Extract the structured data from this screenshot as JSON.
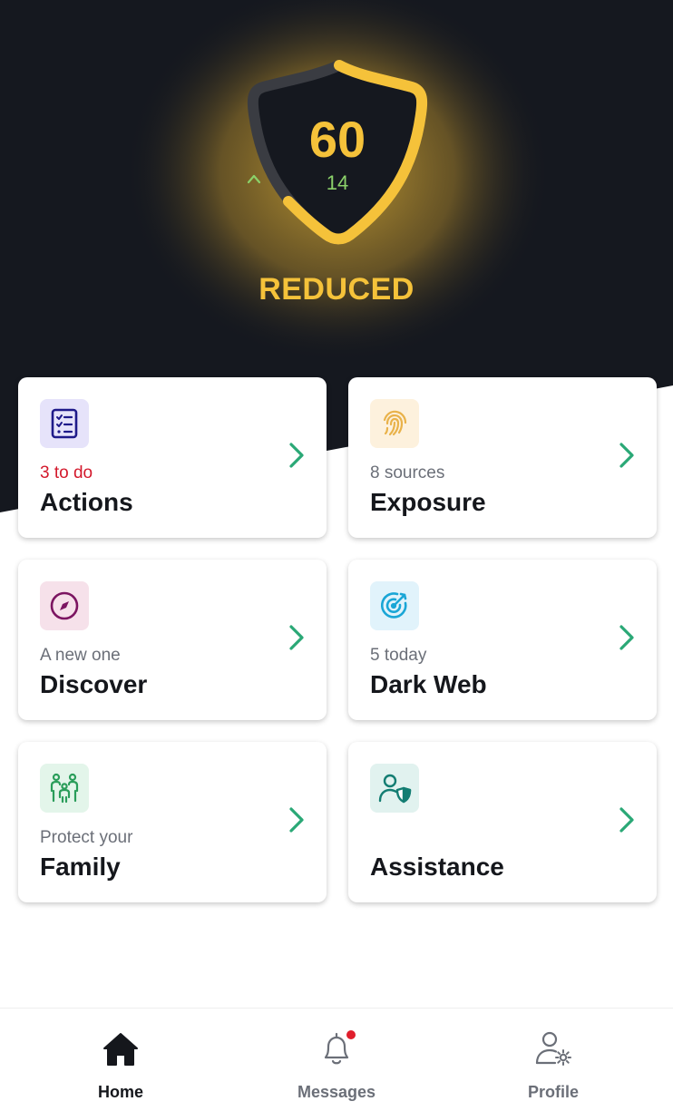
{
  "score": {
    "value": "60",
    "delta": "14",
    "status": "REDUCED",
    "progress_fraction": 0.6,
    "accent_color": "#f5c23a",
    "delta_color": "#8bd16a",
    "background_color": "#15181f"
  },
  "cards": [
    {
      "subtitle": "3 to do",
      "title": "Actions",
      "icon": "checklist-icon",
      "subtitle_color": "#d3192c"
    },
    {
      "subtitle": "8 sources",
      "title": "Exposure",
      "icon": "fingerprint-icon"
    },
    {
      "subtitle": "A new one",
      "title": "Discover",
      "icon": "compass-icon"
    },
    {
      "subtitle": "5 today",
      "title": "Dark Web",
      "icon": "target-icon"
    },
    {
      "subtitle": "Protect your",
      "title": "Family",
      "icon": "family-icon"
    },
    {
      "subtitle": "",
      "title": "Assistance",
      "icon": "user-shield-icon"
    }
  ],
  "nav": {
    "items": [
      {
        "label": "Home",
        "icon": "home-icon",
        "active": true
      },
      {
        "label": "Messages",
        "icon": "bell-icon",
        "has_notification": true
      },
      {
        "label": "Profile",
        "icon": "user-settings-icon"
      }
    ]
  }
}
